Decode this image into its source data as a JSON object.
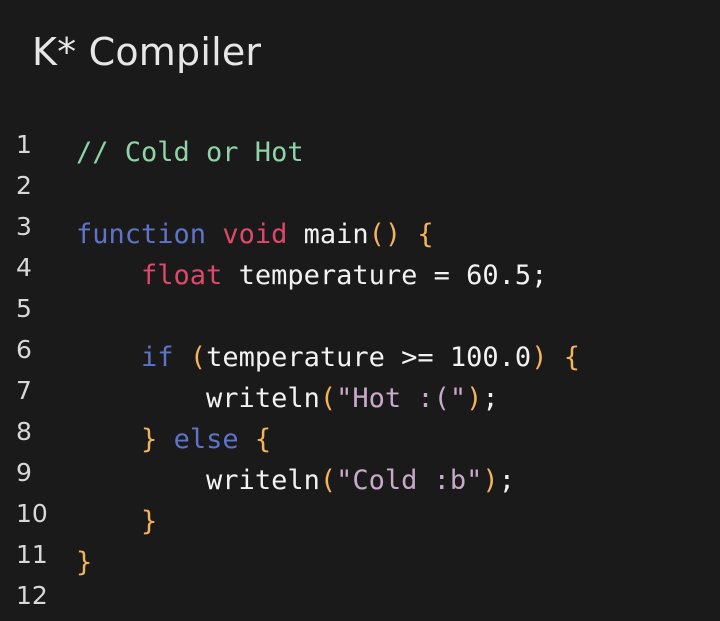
{
  "app": {
    "title": "K* Compiler"
  },
  "colors": {
    "background": "#1a1a1a",
    "comment": "#8fd3a8",
    "keyword": "#5f73c8",
    "type": "#e0476a",
    "bracket": "#f2b35c",
    "string": "#c9a9c9",
    "text": "#f2f2f2"
  },
  "editor": {
    "line_numbers": [
      "1",
      "2",
      "3",
      "4",
      "5",
      "6",
      "7",
      "8",
      "9",
      "10",
      "11",
      "12"
    ],
    "lines": [
      {
        "indent": "",
        "tokens": [
          {
            "t": "comment",
            "v": "// Cold or Hot"
          }
        ]
      },
      {
        "indent": "",
        "tokens": []
      },
      {
        "indent": "",
        "tokens": [
          {
            "t": "kw",
            "v": "function"
          },
          {
            "t": "plain",
            "v": " "
          },
          {
            "t": "type",
            "v": "void"
          },
          {
            "t": "plain",
            "v": " main"
          },
          {
            "t": "paren",
            "v": "()"
          },
          {
            "t": "plain",
            "v": " "
          },
          {
            "t": "paren",
            "v": "{"
          }
        ]
      },
      {
        "indent": "    ",
        "tokens": [
          {
            "t": "type",
            "v": "float"
          },
          {
            "t": "plain",
            "v": " temperature = 60.5;"
          }
        ]
      },
      {
        "indent": "",
        "tokens": []
      },
      {
        "indent": "    ",
        "tokens": [
          {
            "t": "kw",
            "v": "if"
          },
          {
            "t": "plain",
            "v": " "
          },
          {
            "t": "paren",
            "v": "("
          },
          {
            "t": "plain",
            "v": "temperature >= 100.0"
          },
          {
            "t": "paren",
            "v": ")"
          },
          {
            "t": "plain",
            "v": " "
          },
          {
            "t": "paren",
            "v": "{"
          }
        ]
      },
      {
        "indent": "        ",
        "tokens": [
          {
            "t": "plain",
            "v": "writeln"
          },
          {
            "t": "paren",
            "v": "("
          },
          {
            "t": "str",
            "v": "\"Hot :(\""
          },
          {
            "t": "paren",
            "v": ")"
          },
          {
            "t": "plain",
            "v": ";"
          }
        ]
      },
      {
        "indent": "    ",
        "tokens": [
          {
            "t": "paren",
            "v": "}"
          },
          {
            "t": "plain",
            "v": " "
          },
          {
            "t": "kw",
            "v": "else"
          },
          {
            "t": "plain",
            "v": " "
          },
          {
            "t": "paren",
            "v": "{"
          }
        ]
      },
      {
        "indent": "        ",
        "tokens": [
          {
            "t": "plain",
            "v": "writeln"
          },
          {
            "t": "paren",
            "v": "("
          },
          {
            "t": "str",
            "v": "\"Cold :b\""
          },
          {
            "t": "paren",
            "v": ")"
          },
          {
            "t": "plain",
            "v": ";"
          }
        ]
      },
      {
        "indent": "    ",
        "tokens": [
          {
            "t": "paren",
            "v": "}"
          }
        ]
      },
      {
        "indent": "",
        "tokens": [
          {
            "t": "paren",
            "v": "}"
          }
        ]
      },
      {
        "indent": "",
        "tokens": []
      }
    ]
  }
}
